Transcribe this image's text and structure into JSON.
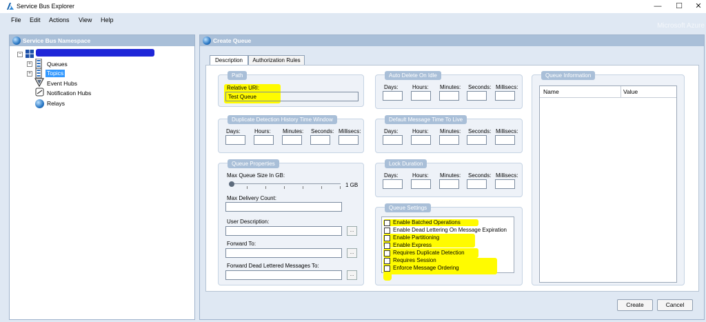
{
  "app": {
    "title": "Service Bus Explorer",
    "brand": "Microsoft Azure"
  },
  "window_controls": {
    "minimize": "—",
    "maximize": "☐",
    "close": "✕"
  },
  "menu": [
    "File",
    "Edit",
    "Actions",
    "View",
    "Help"
  ],
  "left_panel": {
    "header": "Service Bus Namespace",
    "tree": [
      {
        "label": "Queues",
        "icon": "queue-icon"
      },
      {
        "label": "Topics",
        "icon": "topic-icon",
        "selected": true
      },
      {
        "label": "Event Hubs",
        "icon": "event-hub-icon"
      },
      {
        "label": "Notification Hubs",
        "icon": "notification-hub-icon"
      },
      {
        "label": "Relays",
        "icon": "relay-globe-icon"
      }
    ]
  },
  "right_panel": {
    "header": "Create Queue",
    "tabs": [
      "Description",
      "Authorization Rules"
    ],
    "active_tab": "Description",
    "path": {
      "title": "Path",
      "relative_uri_label": "Relative URI:",
      "relative_uri_value": "Test Queue"
    },
    "duplicate_detection": {
      "title": "Duplicate Detection History Time Window",
      "fields": [
        "Days:",
        "Hours:",
        "Minutes:",
        "Seconds:",
        "Millisecs:"
      ]
    },
    "queue_properties": {
      "title": "Queue Properties",
      "max_size_label": "Max Queue Size In GB:",
      "max_size_value": "1 GB",
      "max_delivery_label": "Max Delivery Count:",
      "user_description_label": "User Description:",
      "forward_to_label": "Forward To:",
      "forward_dead_label": "Forward Dead Lettered Messages To:",
      "browse_label": "..."
    },
    "auto_delete": {
      "title": "Auto Delete On Idle",
      "fields": [
        "Days:",
        "Hours:",
        "Minutes:",
        "Seconds:",
        "Millisecs:"
      ]
    },
    "default_ttl": {
      "title": "Default Message Time To Live",
      "fields": [
        "Days:",
        "Hours:",
        "Minutes:",
        "Seconds:",
        "Millisecs:"
      ]
    },
    "lock_duration": {
      "title": "Lock Duration",
      "fields": [
        "Days:",
        "Hours:",
        "Minutes:",
        "Seconds:",
        "Millisecs:"
      ]
    },
    "queue_settings": {
      "title": "Queue Settings",
      "options": [
        "Enable Batched Operations",
        "Enable Dead Lettering On Message Expiration",
        "Enable Partitioning",
        "Enable Express",
        "Requires Duplicate Detection",
        "Requires Session",
        "Enforce Message Ordering"
      ]
    },
    "queue_information": {
      "title": "Queue Information",
      "columns": [
        "Name",
        "Value"
      ]
    },
    "buttons": {
      "create": "Create",
      "cancel": "Cancel"
    }
  },
  "colors": {
    "chrome": "#dfe8f3",
    "header": "#a9bfd8",
    "highlight": "#fffb00",
    "redaction": "#1f26d8",
    "selection": "#3399ff"
  }
}
